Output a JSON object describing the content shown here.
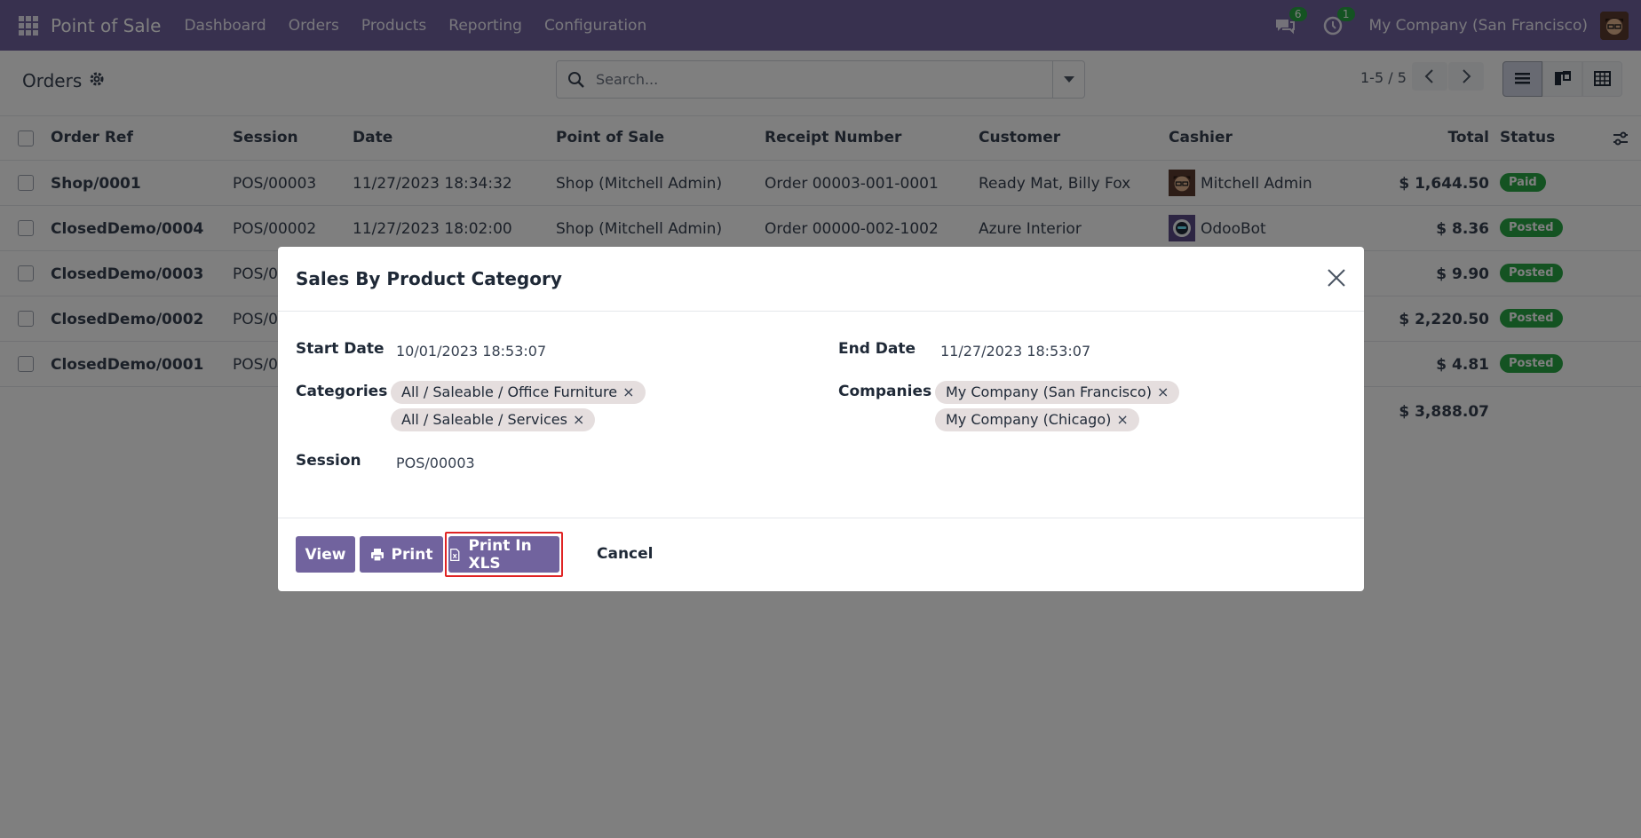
{
  "navbar": {
    "brand": "Point of Sale",
    "menu": [
      "Dashboard",
      "Orders",
      "Products",
      "Reporting",
      "Configuration"
    ],
    "chat_count": "6",
    "activity_count": "1",
    "company": "My Company (San Francisco)"
  },
  "control": {
    "title": "Orders",
    "search_placeholder": "Search...",
    "pager": "1-5 / 5"
  },
  "table": {
    "headers": {
      "ref": "Order Ref",
      "session": "Session",
      "date": "Date",
      "pos": "Point of Sale",
      "receipt": "Receipt Number",
      "customer": "Customer",
      "cashier": "Cashier",
      "total": "Total",
      "status": "Status"
    },
    "rows": [
      {
        "ref": "Shop/0001",
        "session": "POS/00003",
        "date": "11/27/2023 18:34:32",
        "pos": "Shop (Mitchell Admin)",
        "receipt": "Order 00003-001-0001",
        "customer": "Ready Mat, Billy Fox",
        "cashier": "Mitchell Admin",
        "total": "$ 1,644.50",
        "status": "Paid"
      },
      {
        "ref": "ClosedDemo/0004",
        "session": "POS/00002",
        "date": "11/27/2023 18:02:00",
        "pos": "Shop (Mitchell Admin)",
        "receipt": "Order 00000-002-1002",
        "customer": "Azure Interior",
        "cashier": "OdooBot",
        "total": "$ 8.36",
        "status": "Posted"
      },
      {
        "ref": "ClosedDemo/0003",
        "session": "POS/0",
        "total": "$ 9.90",
        "status": "Posted"
      },
      {
        "ref": "ClosedDemo/0002",
        "session": "POS/0",
        "total": "$ 2,220.50",
        "status": "Posted"
      },
      {
        "ref": "ClosedDemo/0001",
        "session": "POS/0",
        "total": "$ 4.81",
        "status": "Posted"
      }
    ],
    "grand_total": "$ 3,888.07"
  },
  "modal": {
    "title": "Sales By Product Category",
    "start_date_label": "Start Date",
    "start_date": "10/01/2023 18:53:07",
    "end_date_label": "End Date",
    "end_date": "11/27/2023 18:53:07",
    "categories_label": "Categories",
    "categories": [
      "All / Saleable / Office Furniture",
      "All / Saleable / Services"
    ],
    "companies_label": "Companies",
    "companies": [
      "My Company (San Francisco)",
      "My Company (Chicago)"
    ],
    "session_label": "Session",
    "session": "POS/00003",
    "buttons": {
      "view": "View",
      "print": "Print",
      "print_xls": "Print In XLS",
      "cancel": "Cancel"
    }
  },
  "colors": {
    "brand": "#71639e",
    "success": "#28a745",
    "highlight": "#e02424"
  }
}
